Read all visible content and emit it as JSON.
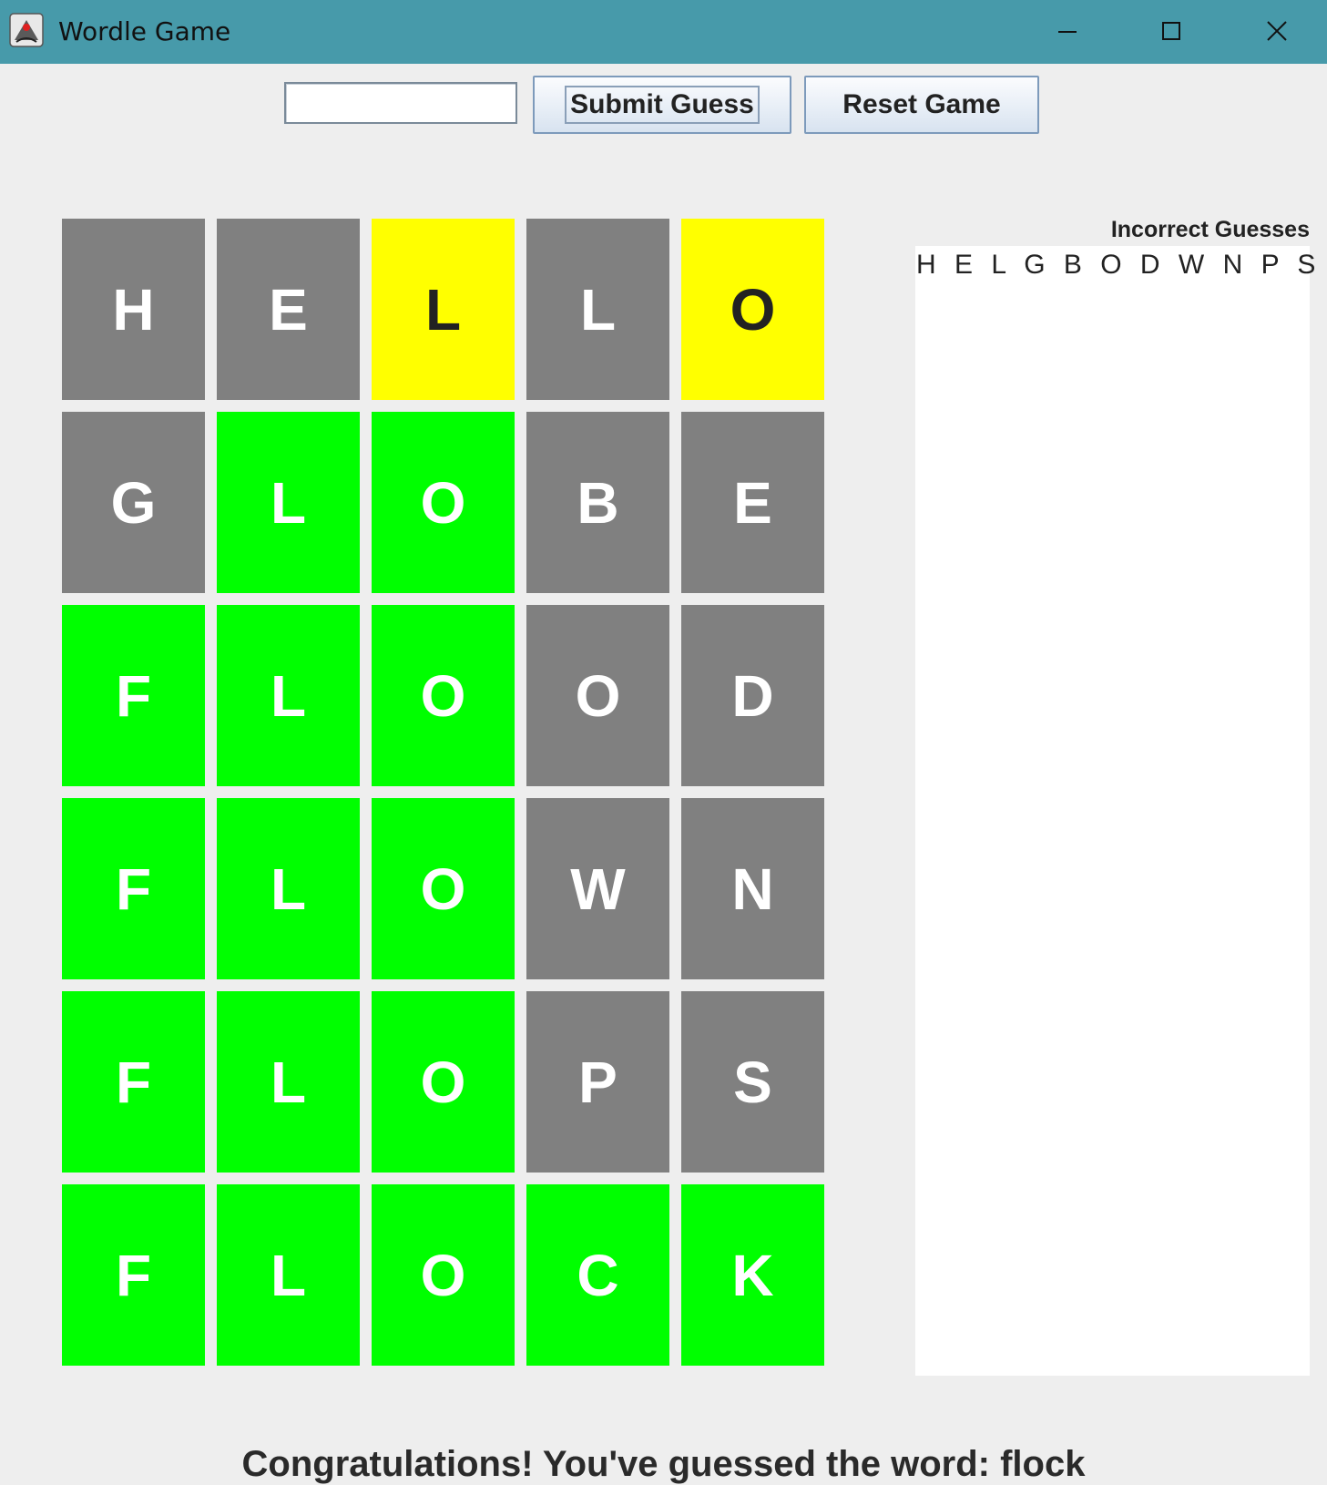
{
  "window": {
    "title": "Wordle Game",
    "controls": [
      "minimize",
      "maximize",
      "close"
    ]
  },
  "toolbar": {
    "guess_input_value": "",
    "submit_label": "Submit Guess",
    "reset_label": "Reset Game"
  },
  "board": {
    "rows": [
      [
        {
          "letter": "H",
          "state": "gray"
        },
        {
          "letter": "E",
          "state": "gray"
        },
        {
          "letter": "L",
          "state": "yellow"
        },
        {
          "letter": "L",
          "state": "gray"
        },
        {
          "letter": "O",
          "state": "yellow"
        }
      ],
      [
        {
          "letter": "G",
          "state": "gray"
        },
        {
          "letter": "L",
          "state": "green"
        },
        {
          "letter": "O",
          "state": "green"
        },
        {
          "letter": "B",
          "state": "gray"
        },
        {
          "letter": "E",
          "state": "gray"
        }
      ],
      [
        {
          "letter": "F",
          "state": "green"
        },
        {
          "letter": "L",
          "state": "green"
        },
        {
          "letter": "O",
          "state": "green"
        },
        {
          "letter": "O",
          "state": "gray"
        },
        {
          "letter": "D",
          "state": "gray"
        }
      ],
      [
        {
          "letter": "F",
          "state": "green"
        },
        {
          "letter": "L",
          "state": "green"
        },
        {
          "letter": "O",
          "state": "green"
        },
        {
          "letter": "W",
          "state": "gray"
        },
        {
          "letter": "N",
          "state": "gray"
        }
      ],
      [
        {
          "letter": "F",
          "state": "green"
        },
        {
          "letter": "L",
          "state": "green"
        },
        {
          "letter": "O",
          "state": "green"
        },
        {
          "letter": "P",
          "state": "gray"
        },
        {
          "letter": "S",
          "state": "gray"
        }
      ],
      [
        {
          "letter": "F",
          "state": "green"
        },
        {
          "letter": "L",
          "state": "green"
        },
        {
          "letter": "O",
          "state": "green"
        },
        {
          "letter": "C",
          "state": "green"
        },
        {
          "letter": "K",
          "state": "green"
        }
      ]
    ],
    "colors": {
      "gray": "#808080",
      "green": "#00ff00",
      "yellow": "#ffff00"
    }
  },
  "incorrect": {
    "label": "Incorrect Guesses",
    "letters": "H E L G B O D W N P S"
  },
  "status_message": "Congratulations! You've guessed the word: flock",
  "theme": {
    "titlebar": "#479aaa",
    "background": "#eeeeee"
  }
}
